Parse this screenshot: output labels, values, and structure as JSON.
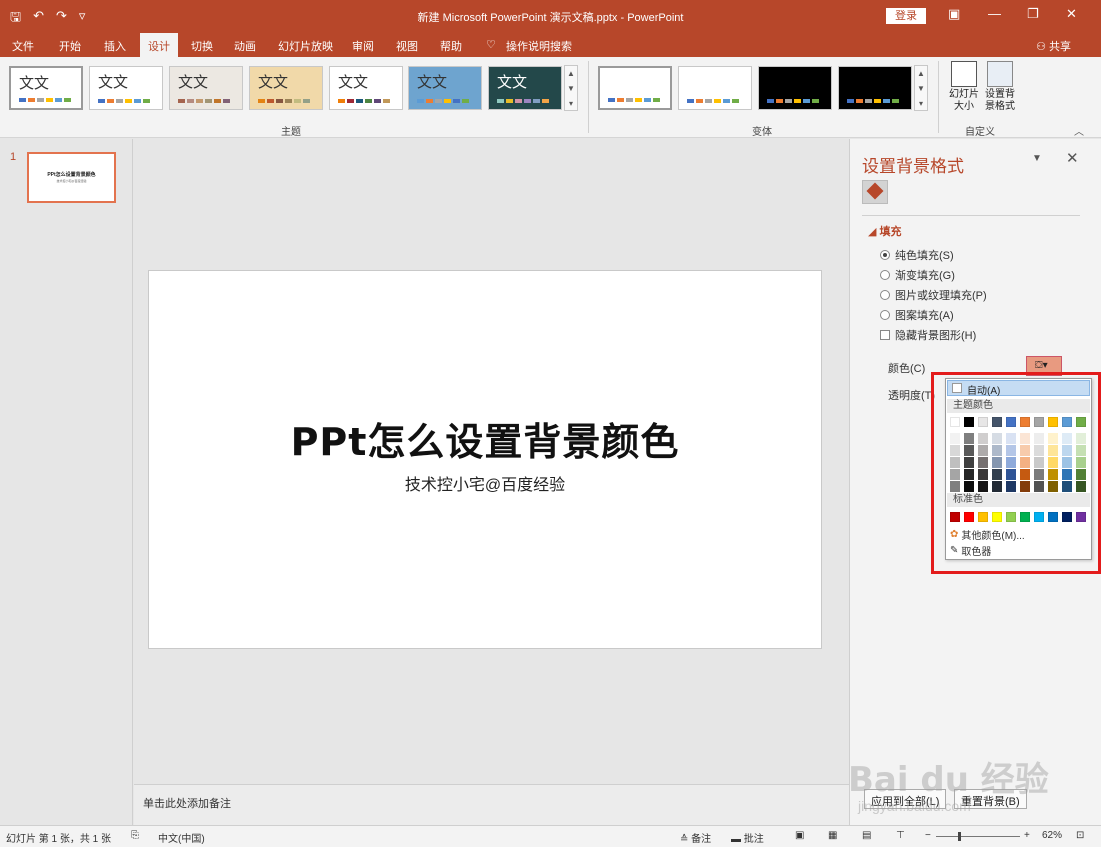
{
  "window": {
    "title": "新建 Microsoft PowerPoint 演示文稿.pptx  -  PowerPoint",
    "login": "登录",
    "qat": {
      "save": "🖫",
      "undo": "↶",
      "redo": "↷",
      "custom": "▿"
    }
  },
  "tabs": [
    "文件",
    "开始",
    "插入",
    "设计",
    "切换",
    "动画",
    "幻灯片放映",
    "审阅",
    "视图",
    "帮助",
    "操作说明搜索"
  ],
  "active_tab": "设计",
  "share": "共享",
  "ribbon": {
    "themes_label": "主题",
    "variants_label": "变体",
    "customize_label": "自定义",
    "theme_text": "文文",
    "slide_size": "幻灯片\n大小",
    "format_bg": "设置背\n景格式"
  },
  "slide_number": "1",
  "slide": {
    "title": "PPt怎么设置背景颜色",
    "subtitle": "技术控小宅@百度经验"
  },
  "notes_placeholder": "单击此处添加备注",
  "pane": {
    "title": "设置背景格式",
    "section": "填充",
    "options": {
      "solid": "纯色填充(S)",
      "gradient": "渐变填充(G)",
      "picture": "图片或纹理填充(P)",
      "pattern": "图案填充(A)",
      "hide_graphics": "隐藏背景图形(H)"
    },
    "color_label": "颜色(C)",
    "transparency_label": "透明度(T)",
    "apply_all": "应用到全部(L)",
    "reset": "重置背景(B)"
  },
  "palette": {
    "auto": "自动(A)",
    "theme_colors_label": "主题颜色",
    "standard_colors_label": "标准色",
    "more_colors": "其他颜色(M)...",
    "eyedropper": "取色器",
    "theme_top": [
      "#ffffff",
      "#000000",
      "#e7e6e6",
      "#44546a",
      "#4472c4",
      "#ed7d31",
      "#a5a5a5",
      "#ffc000",
      "#5b9bd5",
      "#70ad47"
    ],
    "theme_shades": [
      [
        "#f2f2f2",
        "#7f7f7f",
        "#d0cece",
        "#d6dce4",
        "#d9e2f3",
        "#fbe5d5",
        "#ededed",
        "#fff2cc",
        "#deebf6",
        "#e2efd9"
      ],
      [
        "#d8d8d8",
        "#595959",
        "#aeabab",
        "#adb9ca",
        "#b4c6e7",
        "#f7cbac",
        "#dbdbdb",
        "#fee599",
        "#bdd7ee",
        "#c5e0b3"
      ],
      [
        "#bfbfbf",
        "#3f3f3f",
        "#757070",
        "#8496b0",
        "#8eaadb",
        "#f4b183",
        "#c9c9c9",
        "#ffd965",
        "#9cc3e5",
        "#a8d08d"
      ],
      [
        "#a5a5a5",
        "#262626",
        "#3a3838",
        "#323f4f",
        "#2f5496",
        "#c55a11",
        "#7b7b7b",
        "#bf9000",
        "#2e75b5",
        "#538135"
      ],
      [
        "#7f7f7f",
        "#0c0c0c",
        "#171616",
        "#222a35",
        "#1e3864",
        "#833c0b",
        "#525252",
        "#7f6000",
        "#1e4e79",
        "#375623"
      ]
    ],
    "standard": [
      "#c00000",
      "#ff0000",
      "#ffc000",
      "#ffff00",
      "#92d050",
      "#00b050",
      "#00b0f0",
      "#0070c0",
      "#002060",
      "#7030a0"
    ]
  },
  "status": {
    "slide_info": "幻灯片 第 1 张，共 1 张",
    "language": "中文(中国)",
    "notes": "备注",
    "comments": "批注",
    "zoom": "62%"
  },
  "watermark": {
    "main": "Bai du 经验",
    "sub": "jingyan.baidu.com"
  },
  "colors": {
    "accent": "#b7472a",
    "highlight": "#e31b1b"
  }
}
